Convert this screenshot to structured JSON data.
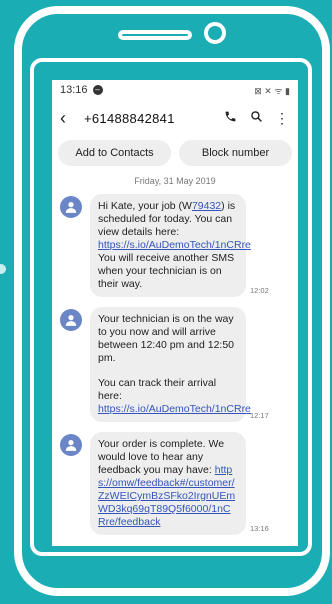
{
  "status": {
    "time": "13:16",
    "icons": "⊠ ✕ ᯤ ▮"
  },
  "header": {
    "contact": "+61488842841"
  },
  "actions": {
    "add_contacts": "Add to Contacts",
    "block_number": "Block number"
  },
  "date_divider": "Friday, 31 May 2019",
  "messages": [
    {
      "t1": "Hi Kate, your job (W",
      "link_job": "79432",
      "t2": ") is scheduled for today. You can view details here: ",
      "link1": "https://s.io/AuDemoTech/1nCRre",
      "t3": " You will receive another SMS when your technician is on their way.",
      "time": "12:02"
    },
    {
      "t1": "Your technician is on the way to you now and will arrive between 12:40 pm and 12:50 pm.",
      "t2": "You can track their arrival here: ",
      "link1": "https://s.io/AuDemoTech/1nCRre",
      "time": "12:17"
    },
    {
      "t1": "Your order is complete. We would love to hear any feedback you may have: ",
      "link1": "https://omw/feedback#/customer/ZzWEICymBzSFko2IrgnUEmWD3kq69qT89Q5f6000/1nCRre/feedback",
      "time": "13:16"
    }
  ],
  "colors": {
    "background": "#1aaeb4",
    "avatar": "#6a86c6",
    "bubble": "#eeeeee",
    "link": "#3355bb"
  }
}
